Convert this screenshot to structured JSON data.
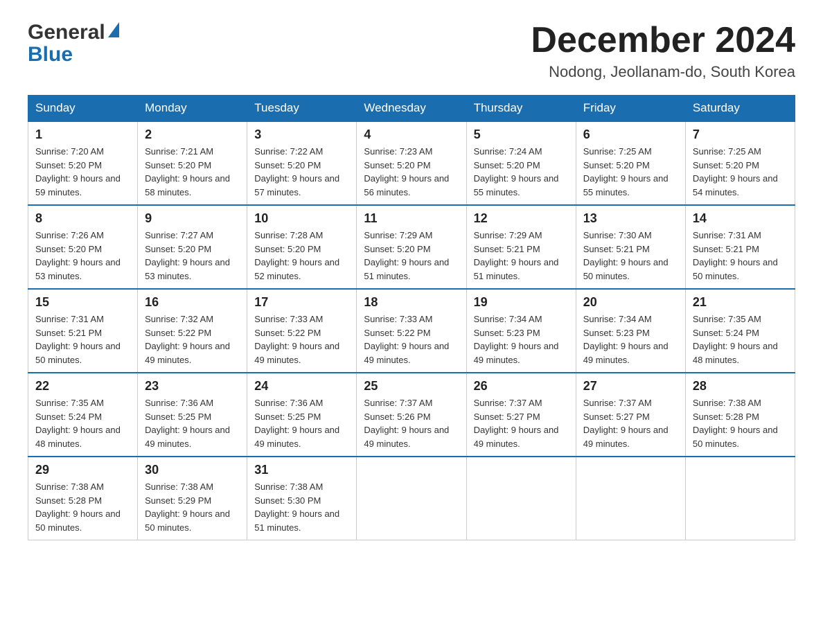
{
  "header": {
    "logo_general": "General",
    "logo_blue": "Blue",
    "month_title": "December 2024",
    "location": "Nodong, Jeollanam-do, South Korea"
  },
  "weekdays": [
    "Sunday",
    "Monday",
    "Tuesday",
    "Wednesday",
    "Thursday",
    "Friday",
    "Saturday"
  ],
  "weeks": [
    [
      {
        "day": "1",
        "sunrise": "7:20 AM",
        "sunset": "5:20 PM",
        "daylight": "9 hours and 59 minutes."
      },
      {
        "day": "2",
        "sunrise": "7:21 AM",
        "sunset": "5:20 PM",
        "daylight": "9 hours and 58 minutes."
      },
      {
        "day": "3",
        "sunrise": "7:22 AM",
        "sunset": "5:20 PM",
        "daylight": "9 hours and 57 minutes."
      },
      {
        "day": "4",
        "sunrise": "7:23 AM",
        "sunset": "5:20 PM",
        "daylight": "9 hours and 56 minutes."
      },
      {
        "day": "5",
        "sunrise": "7:24 AM",
        "sunset": "5:20 PM",
        "daylight": "9 hours and 55 minutes."
      },
      {
        "day": "6",
        "sunrise": "7:25 AM",
        "sunset": "5:20 PM",
        "daylight": "9 hours and 55 minutes."
      },
      {
        "day": "7",
        "sunrise": "7:25 AM",
        "sunset": "5:20 PM",
        "daylight": "9 hours and 54 minutes."
      }
    ],
    [
      {
        "day": "8",
        "sunrise": "7:26 AM",
        "sunset": "5:20 PM",
        "daylight": "9 hours and 53 minutes."
      },
      {
        "day": "9",
        "sunrise": "7:27 AM",
        "sunset": "5:20 PM",
        "daylight": "9 hours and 53 minutes."
      },
      {
        "day": "10",
        "sunrise": "7:28 AM",
        "sunset": "5:20 PM",
        "daylight": "9 hours and 52 minutes."
      },
      {
        "day": "11",
        "sunrise": "7:29 AM",
        "sunset": "5:20 PM",
        "daylight": "9 hours and 51 minutes."
      },
      {
        "day": "12",
        "sunrise": "7:29 AM",
        "sunset": "5:21 PM",
        "daylight": "9 hours and 51 minutes."
      },
      {
        "day": "13",
        "sunrise": "7:30 AM",
        "sunset": "5:21 PM",
        "daylight": "9 hours and 50 minutes."
      },
      {
        "day": "14",
        "sunrise": "7:31 AM",
        "sunset": "5:21 PM",
        "daylight": "9 hours and 50 minutes."
      }
    ],
    [
      {
        "day": "15",
        "sunrise": "7:31 AM",
        "sunset": "5:21 PM",
        "daylight": "9 hours and 50 minutes."
      },
      {
        "day": "16",
        "sunrise": "7:32 AM",
        "sunset": "5:22 PM",
        "daylight": "9 hours and 49 minutes."
      },
      {
        "day": "17",
        "sunrise": "7:33 AM",
        "sunset": "5:22 PM",
        "daylight": "9 hours and 49 minutes."
      },
      {
        "day": "18",
        "sunrise": "7:33 AM",
        "sunset": "5:22 PM",
        "daylight": "9 hours and 49 minutes."
      },
      {
        "day": "19",
        "sunrise": "7:34 AM",
        "sunset": "5:23 PM",
        "daylight": "9 hours and 49 minutes."
      },
      {
        "day": "20",
        "sunrise": "7:34 AM",
        "sunset": "5:23 PM",
        "daylight": "9 hours and 49 minutes."
      },
      {
        "day": "21",
        "sunrise": "7:35 AM",
        "sunset": "5:24 PM",
        "daylight": "9 hours and 48 minutes."
      }
    ],
    [
      {
        "day": "22",
        "sunrise": "7:35 AM",
        "sunset": "5:24 PM",
        "daylight": "9 hours and 48 minutes."
      },
      {
        "day": "23",
        "sunrise": "7:36 AM",
        "sunset": "5:25 PM",
        "daylight": "9 hours and 49 minutes."
      },
      {
        "day": "24",
        "sunrise": "7:36 AM",
        "sunset": "5:25 PM",
        "daylight": "9 hours and 49 minutes."
      },
      {
        "day": "25",
        "sunrise": "7:37 AM",
        "sunset": "5:26 PM",
        "daylight": "9 hours and 49 minutes."
      },
      {
        "day": "26",
        "sunrise": "7:37 AM",
        "sunset": "5:27 PM",
        "daylight": "9 hours and 49 minutes."
      },
      {
        "day": "27",
        "sunrise": "7:37 AM",
        "sunset": "5:27 PM",
        "daylight": "9 hours and 49 minutes."
      },
      {
        "day": "28",
        "sunrise": "7:38 AM",
        "sunset": "5:28 PM",
        "daylight": "9 hours and 50 minutes."
      }
    ],
    [
      {
        "day": "29",
        "sunrise": "7:38 AM",
        "sunset": "5:28 PM",
        "daylight": "9 hours and 50 minutes."
      },
      {
        "day": "30",
        "sunrise": "7:38 AM",
        "sunset": "5:29 PM",
        "daylight": "9 hours and 50 minutes."
      },
      {
        "day": "31",
        "sunrise": "7:38 AM",
        "sunset": "5:30 PM",
        "daylight": "9 hours and 51 minutes."
      },
      null,
      null,
      null,
      null
    ]
  ]
}
